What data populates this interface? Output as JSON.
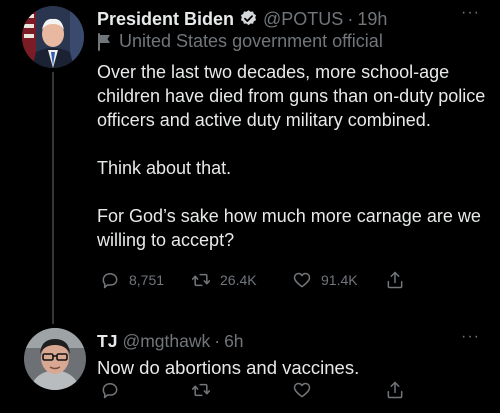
{
  "tweets": [
    {
      "display_name": "President Biden",
      "handle": "@POTUS",
      "separator": "·",
      "time": "19h",
      "label": "United States government official",
      "paragraphs": [
        "Over the last two decades, more school-age children have died from guns than on-duty police officers and active duty military combined.",
        "Think about that.",
        "For God’s sake how much more carnage are we willing to accept?"
      ],
      "replies": "8,751",
      "retweets": "26.4K",
      "likes": "91.4K",
      "more": "···"
    },
    {
      "display_name": "TJ",
      "handle": "@mgthawk",
      "separator": "·",
      "time": "6h",
      "text": "Now do abortions and vaccines.",
      "more": "···"
    }
  ],
  "colors": {
    "background": "#000000",
    "text": "#e7e9ea",
    "muted": "#71767b",
    "verified": "#1d9bf0"
  },
  "icons": [
    "verified-badge-icon",
    "government-flag-icon",
    "reply-icon",
    "retweet-icon",
    "like-icon",
    "share-icon",
    "more-icon"
  ]
}
